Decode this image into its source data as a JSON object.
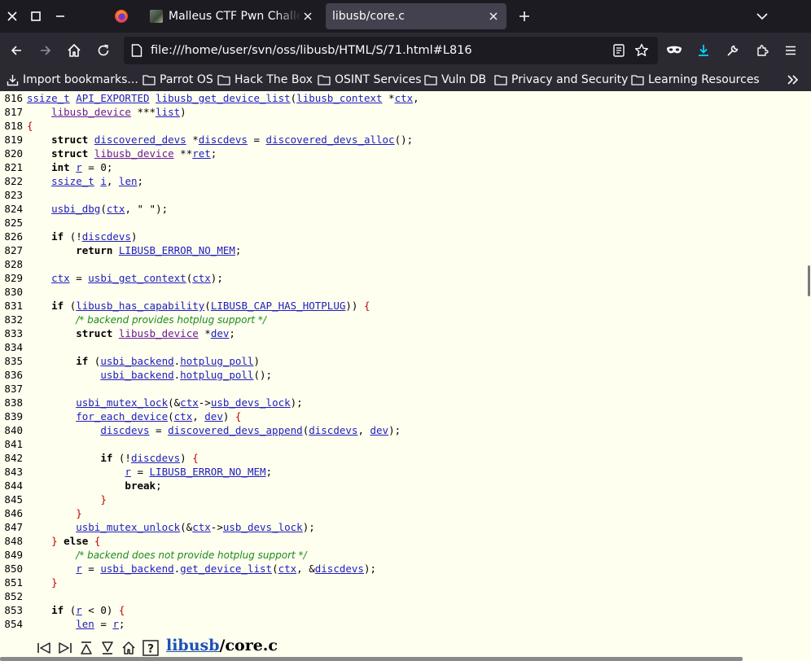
{
  "browser": {
    "tabs": [
      {
        "title": "Malleus CTF Pwn Challeng",
        "active": false
      },
      {
        "title": "libusb/core.c",
        "active": true
      }
    ],
    "url": "file:///home/user/svn/oss/libusb/HTML/S/71.html#L816",
    "bookmarks": [
      {
        "label": "Import bookmarks...",
        "icon": "import-icon"
      },
      {
        "label": "Parrot OS",
        "icon": "folder-icon"
      },
      {
        "label": "Hack The Box",
        "icon": "folder-icon"
      },
      {
        "label": "OSINT Services",
        "icon": "folder-icon"
      },
      {
        "label": "Vuln DB",
        "icon": "folder-icon"
      },
      {
        "label": "Privacy and Security",
        "icon": "folder-icon"
      },
      {
        "label": "Learning Resources",
        "icon": "folder-icon"
      }
    ],
    "colors": {
      "tabbar": "#1c1b22",
      "toolbar": "#2b2a33",
      "active_tab": "#42414d",
      "accent": "#00ddff"
    }
  },
  "code": {
    "lines": [
      {
        "n": "816",
        "t": [
          [
            "a",
            "ssize_t"
          ],
          [
            "s",
            " "
          ],
          [
            "a",
            "API_EXPORTED"
          ],
          [
            "s",
            " "
          ],
          [
            "a",
            "libusb_get_device_list"
          ],
          [
            "s",
            "("
          ],
          [
            "a",
            "libusb_context"
          ],
          [
            "s",
            " *"
          ],
          [
            "a",
            "ctx"
          ],
          [
            "s",
            ","
          ]
        ]
      },
      {
        "n": "817",
        "t": [
          [
            "s",
            "    "
          ],
          [
            "ad",
            "libusb_device"
          ],
          [
            "s",
            " ***"
          ],
          [
            "a",
            "list"
          ],
          [
            "s",
            ")"
          ]
        ]
      },
      {
        "n": "818",
        "t": [
          [
            "b",
            "{"
          ]
        ]
      },
      {
        "n": "819",
        "t": [
          [
            "s",
            "    "
          ],
          [
            "k",
            "struct"
          ],
          [
            "s",
            " "
          ],
          [
            "a",
            "discovered_devs"
          ],
          [
            "s",
            " *"
          ],
          [
            "a",
            "discdevs"
          ],
          [
            "s",
            " = "
          ],
          [
            "a",
            "discovered_devs_alloc"
          ],
          [
            "s",
            "();"
          ]
        ]
      },
      {
        "n": "820",
        "t": [
          [
            "s",
            "    "
          ],
          [
            "k",
            "struct"
          ],
          [
            "s",
            " "
          ],
          [
            "ad",
            "libusb_device"
          ],
          [
            "s",
            " **"
          ],
          [
            "a",
            "ret"
          ],
          [
            "s",
            ";"
          ]
        ]
      },
      {
        "n": "821",
        "t": [
          [
            "s",
            "    "
          ],
          [
            "k",
            "int"
          ],
          [
            "s",
            " "
          ],
          [
            "a",
            "r"
          ],
          [
            "s",
            " = 0;"
          ]
        ]
      },
      {
        "n": "822",
        "t": [
          [
            "s",
            "    "
          ],
          [
            "a",
            "ssize_t"
          ],
          [
            "s",
            " "
          ],
          [
            "a",
            "i"
          ],
          [
            "s",
            ", "
          ],
          [
            "a",
            "len"
          ],
          [
            "s",
            ";"
          ]
        ]
      },
      {
        "n": "823",
        "t": []
      },
      {
        "n": "824",
        "t": [
          [
            "s",
            "    "
          ],
          [
            "a",
            "usbi_dbg"
          ],
          [
            "s",
            "("
          ],
          [
            "a",
            "ctx"
          ],
          [
            "s",
            ", \" \");"
          ]
        ]
      },
      {
        "n": "825",
        "t": []
      },
      {
        "n": "826",
        "t": [
          [
            "s",
            "    "
          ],
          [
            "k",
            "if"
          ],
          [
            "s",
            " (!"
          ],
          [
            "a",
            "discdevs"
          ],
          [
            "s",
            ")"
          ]
        ]
      },
      {
        "n": "827",
        "t": [
          [
            "s",
            "        "
          ],
          [
            "k",
            "return"
          ],
          [
            "s",
            " "
          ],
          [
            "a",
            "LIBUSB_ERROR_NO_MEM"
          ],
          [
            "s",
            ";"
          ]
        ]
      },
      {
        "n": "828",
        "t": []
      },
      {
        "n": "829",
        "t": [
          [
            "s",
            "    "
          ],
          [
            "a",
            "ctx"
          ],
          [
            "s",
            " = "
          ],
          [
            "a",
            "usbi_get_context"
          ],
          [
            "s",
            "("
          ],
          [
            "a",
            "ctx"
          ],
          [
            "s",
            ");"
          ]
        ]
      },
      {
        "n": "830",
        "t": []
      },
      {
        "n": "831",
        "t": [
          [
            "s",
            "    "
          ],
          [
            "k",
            "if"
          ],
          [
            "s",
            " ("
          ],
          [
            "a",
            "libusb_has_capability"
          ],
          [
            "s",
            "("
          ],
          [
            "a",
            "LIBUSB_CAP_HAS_HOTPLUG"
          ],
          [
            "s",
            ")) "
          ],
          [
            "b",
            "{"
          ]
        ]
      },
      {
        "n": "832",
        "t": [
          [
            "s",
            "        "
          ],
          [
            "c",
            "/* backend provides hotplug support */"
          ]
        ]
      },
      {
        "n": "833",
        "t": [
          [
            "s",
            "        "
          ],
          [
            "k",
            "struct"
          ],
          [
            "s",
            " "
          ],
          [
            "ad",
            "libusb_device"
          ],
          [
            "s",
            " *"
          ],
          [
            "a",
            "dev"
          ],
          [
            "s",
            ";"
          ]
        ]
      },
      {
        "n": "834",
        "t": []
      },
      {
        "n": "835",
        "t": [
          [
            "s",
            "        "
          ],
          [
            "k",
            "if"
          ],
          [
            "s",
            " ("
          ],
          [
            "a",
            "usbi_backend"
          ],
          [
            "s",
            "."
          ],
          [
            "a",
            "hotplug_poll"
          ],
          [
            "s",
            ")"
          ]
        ]
      },
      {
        "n": "836",
        "t": [
          [
            "s",
            "            "
          ],
          [
            "a",
            "usbi_backend"
          ],
          [
            "s",
            "."
          ],
          [
            "a",
            "hotplug_poll"
          ],
          [
            "s",
            "();"
          ]
        ]
      },
      {
        "n": "837",
        "t": []
      },
      {
        "n": "838",
        "t": [
          [
            "s",
            "        "
          ],
          [
            "a",
            "usbi_mutex_lock"
          ],
          [
            "s",
            "(&"
          ],
          [
            "a",
            "ctx"
          ],
          [
            "s",
            "->"
          ],
          [
            "a",
            "usb_devs_lock"
          ],
          [
            "s",
            ");"
          ]
        ]
      },
      {
        "n": "839",
        "t": [
          [
            "s",
            "        "
          ],
          [
            "a",
            "for_each_device"
          ],
          [
            "s",
            "("
          ],
          [
            "a",
            "ctx"
          ],
          [
            "s",
            ", "
          ],
          [
            "a",
            "dev"
          ],
          [
            "s",
            ") "
          ],
          [
            "b",
            "{"
          ]
        ]
      },
      {
        "n": "840",
        "t": [
          [
            "s",
            "            "
          ],
          [
            "a",
            "discdevs"
          ],
          [
            "s",
            " = "
          ],
          [
            "a",
            "discovered_devs_append"
          ],
          [
            "s",
            "("
          ],
          [
            "a",
            "discdevs"
          ],
          [
            "s",
            ", "
          ],
          [
            "a",
            "dev"
          ],
          [
            "s",
            ");"
          ]
        ]
      },
      {
        "n": "841",
        "t": []
      },
      {
        "n": "842",
        "t": [
          [
            "s",
            "            "
          ],
          [
            "k",
            "if"
          ],
          [
            "s",
            " (!"
          ],
          [
            "a",
            "discdevs"
          ],
          [
            "s",
            ") "
          ],
          [
            "b",
            "{"
          ]
        ]
      },
      {
        "n": "843",
        "t": [
          [
            "s",
            "                "
          ],
          [
            "a",
            "r"
          ],
          [
            "s",
            " = "
          ],
          [
            "a",
            "LIBUSB_ERROR_NO_MEM"
          ],
          [
            "s",
            ";"
          ]
        ]
      },
      {
        "n": "844",
        "t": [
          [
            "s",
            "                "
          ],
          [
            "k",
            "break"
          ],
          [
            "s",
            ";"
          ]
        ]
      },
      {
        "n": "845",
        "t": [
          [
            "s",
            "            "
          ],
          [
            "b",
            "}"
          ]
        ]
      },
      {
        "n": "846",
        "t": [
          [
            "s",
            "        "
          ],
          [
            "b",
            "}"
          ]
        ]
      },
      {
        "n": "847",
        "t": [
          [
            "s",
            "        "
          ],
          [
            "a",
            "usbi_mutex_unlock"
          ],
          [
            "s",
            "(&"
          ],
          [
            "a",
            "ctx"
          ],
          [
            "s",
            "->"
          ],
          [
            "a",
            "usb_devs_lock"
          ],
          [
            "s",
            ");"
          ]
        ]
      },
      {
        "n": "848",
        "t": [
          [
            "s",
            "    "
          ],
          [
            "b",
            "}"
          ],
          [
            "s",
            " "
          ],
          [
            "k",
            "else"
          ],
          [
            "s",
            " "
          ],
          [
            "b",
            "{"
          ]
        ]
      },
      {
        "n": "849",
        "t": [
          [
            "s",
            "        "
          ],
          [
            "c",
            "/* backend does not provide hotplug support */"
          ]
        ]
      },
      {
        "n": "850",
        "t": [
          [
            "s",
            "        "
          ],
          [
            "a",
            "r"
          ],
          [
            "s",
            " = "
          ],
          [
            "a",
            "usbi_backend"
          ],
          [
            "s",
            "."
          ],
          [
            "a",
            "get_device_list"
          ],
          [
            "s",
            "("
          ],
          [
            "a",
            "ctx"
          ],
          [
            "s",
            ", &"
          ],
          [
            "a",
            "discdevs"
          ],
          [
            "s",
            ");"
          ]
        ]
      },
      {
        "n": "851",
        "t": [
          [
            "s",
            "    "
          ],
          [
            "b",
            "}"
          ]
        ]
      },
      {
        "n": "852",
        "t": []
      },
      {
        "n": "853",
        "t": [
          [
            "s",
            "    "
          ],
          [
            "k",
            "if"
          ],
          [
            "s",
            " ("
          ],
          [
            "a",
            "r"
          ],
          [
            "s",
            " < 0) "
          ],
          [
            "b",
            "{"
          ]
        ]
      },
      {
        "n": "854",
        "t": [
          [
            "s",
            "        "
          ],
          [
            "a",
            "len"
          ],
          [
            "s",
            " = "
          ],
          [
            "a",
            "r"
          ],
          [
            "s",
            ";"
          ]
        ]
      }
    ]
  },
  "footer": {
    "path_link": "libusb",
    "path_rest": "/core.c",
    "nav_icons": [
      "first-page-icon",
      "last-page-icon",
      "top-icon",
      "bottom-icon",
      "home-icon",
      "help-icon"
    ]
  }
}
